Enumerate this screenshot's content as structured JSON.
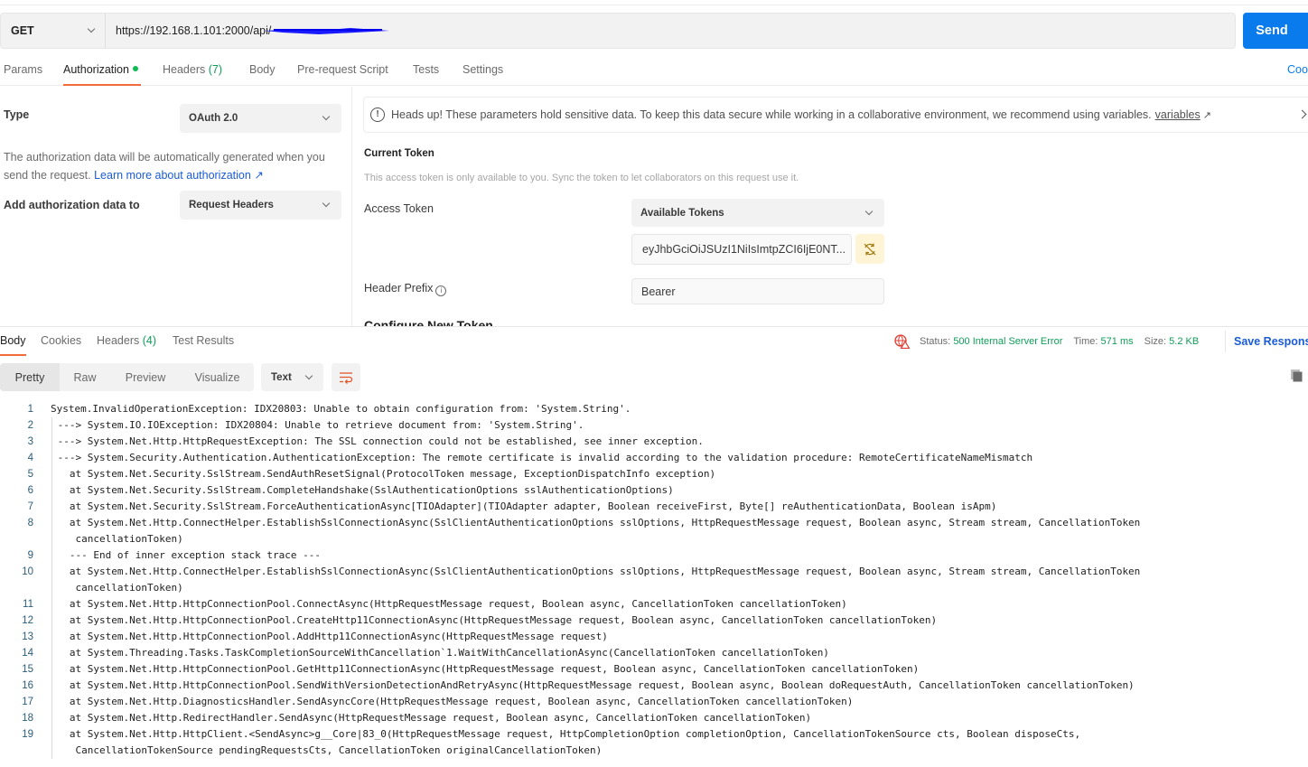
{
  "request": {
    "method": "GET",
    "url": "https://192.168.1.101:2000/api/",
    "url_redacted": true,
    "send_label": "Send"
  },
  "request_tabs": [
    {
      "label": "Params",
      "active": false
    },
    {
      "label": "Authorization",
      "active": true,
      "indicator": "green-dot"
    },
    {
      "label": "Headers",
      "count": "(7)",
      "active": false
    },
    {
      "label": "Body",
      "active": false
    },
    {
      "label": "Pre-request Script",
      "active": false
    },
    {
      "label": "Tests",
      "active": false
    },
    {
      "label": "Settings",
      "active": false
    }
  ],
  "cookies_link": "Coo",
  "auth": {
    "type_label": "Type",
    "type_value": "OAuth 2.0",
    "description": "The authorization data will be automatically generated when you send the request.",
    "learn_more": "Learn more about authorization",
    "learn_more_arrow": "↗",
    "add_to_label": "Add authorization data to",
    "add_to_value": "Request Headers"
  },
  "heads_up": {
    "text": "Heads up! These parameters hold sensitive data. To keep this data secure while working in a collaborative environment, we recommend using variables.",
    "link": "variables",
    "arrow": "↗"
  },
  "current_token": {
    "title": "Current Token",
    "description": "This access token is only available to you. Sync the token to let collaborators on this request use it.",
    "access_token_label": "Access Token",
    "available_tokens": "Available Tokens",
    "token_value": "eyJhbGciOiJSUzI1NiIsImtpZCI6IjE0NT...",
    "header_prefix_label": "Header Prefix",
    "header_prefix_value": "Bearer",
    "configure_new": "Configure New Token"
  },
  "response_tabs": [
    {
      "label": "Body",
      "active": true
    },
    {
      "label": "Cookies",
      "active": false
    },
    {
      "label": "Headers",
      "count": "(4)",
      "active": false
    },
    {
      "label": "Test Results",
      "active": false
    }
  ],
  "response_status": {
    "status_label": "Status:",
    "status_value": "500 Internal Server Error",
    "time_label": "Time:",
    "time_value": "571 ms",
    "size_label": "Size:",
    "size_value": "5.2 KB",
    "save_label": "Save Respons"
  },
  "view_modes": [
    {
      "label": "Pretty",
      "active": true
    },
    {
      "label": "Raw",
      "active": false
    },
    {
      "label": "Preview",
      "active": false
    },
    {
      "label": "Visualize",
      "active": false
    }
  ],
  "format_select": "Text",
  "colors": {
    "accent": "#f26b3a",
    "send": "#097bed",
    "link": "#1a5bd6",
    "success_green": "#0f9d58",
    "error_red": "#e03c31"
  },
  "response_body": [
    {
      "n": "1",
      "text": "System.InvalidOperationException: IDX20803: Unable to obtain configuration from: 'System.String'."
    },
    {
      "n": "2",
      "text": " ---> System.IO.IOException: IDX20804: Unable to retrieve document from: 'System.String'."
    },
    {
      "n": "3",
      "text": " ---> System.Net.Http.HttpRequestException: The SSL connection could not be established, see inner exception."
    },
    {
      "n": "4",
      "text": " ---> System.Security.Authentication.AuthenticationException: The remote certificate is invalid according to the validation procedure: RemoteCertificateNameMismatch"
    },
    {
      "n": "5",
      "text": "   at System.Net.Security.SslStream.SendAuthResetSignal(ProtocolToken message, ExceptionDispatchInfo exception)"
    },
    {
      "n": "6",
      "text": "   at System.Net.Security.SslStream.CompleteHandshake(SslAuthenticationOptions sslAuthenticationOptions)"
    },
    {
      "n": "7",
      "text": "   at System.Net.Security.SslStream.ForceAuthenticationAsync[TIOAdapter](TIOAdapter adapter, Boolean receiveFirst, Byte[] reAuthenticationData, Boolean isApm)"
    },
    {
      "n": "8",
      "text": "   at System.Net.Http.ConnectHelper.EstablishSslConnectionAsync(SslClientAuthenticationOptions sslOptions, HttpRequestMessage request, Boolean async, Stream stream, CancellationToken"
    },
    {
      "n": "",
      "text": "    cancellationToken)"
    },
    {
      "n": "9",
      "text": "   --- End of inner exception stack trace ---"
    },
    {
      "n": "10",
      "text": "   at System.Net.Http.ConnectHelper.EstablishSslConnectionAsync(SslClientAuthenticationOptions sslOptions, HttpRequestMessage request, Boolean async, Stream stream, CancellationToken"
    },
    {
      "n": "",
      "text": "    cancellationToken)"
    },
    {
      "n": "11",
      "text": "   at System.Net.Http.HttpConnectionPool.ConnectAsync(HttpRequestMessage request, Boolean async, CancellationToken cancellationToken)"
    },
    {
      "n": "12",
      "text": "   at System.Net.Http.HttpConnectionPool.CreateHttp11ConnectionAsync(HttpRequestMessage request, Boolean async, CancellationToken cancellationToken)"
    },
    {
      "n": "13",
      "text": "   at System.Net.Http.HttpConnectionPool.AddHttp11ConnectionAsync(HttpRequestMessage request)"
    },
    {
      "n": "14",
      "text": "   at System.Threading.Tasks.TaskCompletionSourceWithCancellation`1.WaitWithCancellationAsync(CancellationToken cancellationToken)"
    },
    {
      "n": "15",
      "text": "   at System.Net.Http.HttpConnectionPool.GetHttp11ConnectionAsync(HttpRequestMessage request, Boolean async, CancellationToken cancellationToken)"
    },
    {
      "n": "16",
      "text": "   at System.Net.Http.HttpConnectionPool.SendWithVersionDetectionAndRetryAsync(HttpRequestMessage request, Boolean async, Boolean doRequestAuth, CancellationToken cancellationToken)"
    },
    {
      "n": "17",
      "text": "   at System.Net.Http.DiagnosticsHandler.SendAsyncCore(HttpRequestMessage request, Boolean async, CancellationToken cancellationToken)"
    },
    {
      "n": "18",
      "text": "   at System.Net.Http.RedirectHandler.SendAsync(HttpRequestMessage request, Boolean async, CancellationToken cancellationToken)"
    },
    {
      "n": "19",
      "text": "   at System.Net.Http.HttpClient.<SendAsync>g__Core|83_0(HttpRequestMessage request, HttpCompletionOption completionOption, CancellationTokenSource cts, Boolean disposeCts,"
    },
    {
      "n": "",
      "text": "    CancellationTokenSource pendingRequestsCts, CancellationToken originalCancellationToken)"
    }
  ]
}
